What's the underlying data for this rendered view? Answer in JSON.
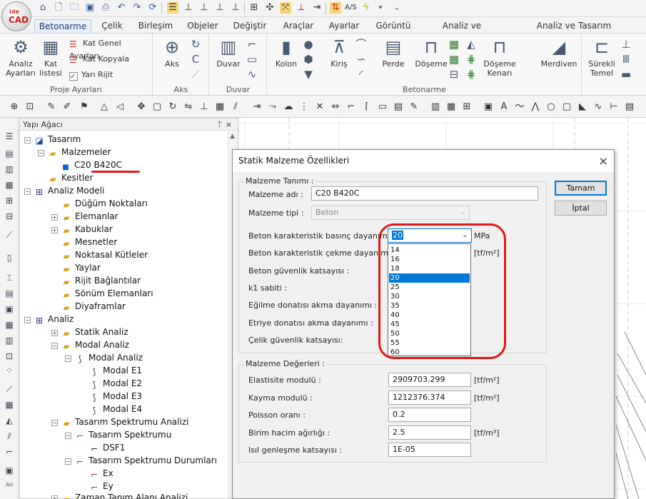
{
  "quick_toolbar": {
    "icons": [
      "home-icon",
      "new-file-icon",
      "open-folder-icon",
      "save-icon",
      "print-icon",
      "print-preview-icon",
      "undo-icon",
      "redo-icon",
      "refresh-icon",
      "select-window-icon",
      "align-left-icon",
      "align-center-icon",
      "align-right-icon",
      "grid-snap-icon",
      "move-icon",
      "snap-active-icon",
      "ortho-icon",
      "pan-icon",
      "snap-end-icon",
      "text-style-icon",
      "lightning-icon",
      "dropdown-icon"
    ],
    "text_label": "A/S"
  },
  "tabs": [
    "Betonarme",
    "Çelik",
    "Birleşim",
    "Objeler",
    "Değiştir",
    "Araçlar",
    "Ayarlar",
    "Görüntü",
    "Analiz ve Tasarım",
    "Analiz ve Tasarım Görüntüleme"
  ],
  "active_tab": "Betonarme",
  "ribbon": {
    "proje": {
      "label": "Proje Ayarları",
      "analiz_btn": "Analiz Ayarları",
      "kat_btn": "Kat listesi",
      "small": [
        "Kat Genel Ayarları",
        "Kat Kopyala",
        "Yarı Rijit"
      ]
    },
    "aks": {
      "label": "Aks",
      "btn": "Aks"
    },
    "duvar": {
      "label": "Duvar",
      "btn": "Duvar"
    },
    "betonarme": {
      "label": "Betonarme",
      "buttons": [
        "Kolon",
        "Kiriş",
        "Perde",
        "Döşeme",
        "Döşeme Kenarı",
        "Merdiven"
      ]
    },
    "temel": {
      "btn": "Sürekli Temel"
    }
  },
  "tree": {
    "header": "Yapı Ağacı",
    "pin": "ᛘ",
    "close": "×",
    "nodes": [
      {
        "text": "Tasarım"
      },
      {
        "text": "Malzemeler"
      },
      {
        "text": "C20 B420C"
      },
      {
        "text": "Kesitler"
      },
      {
        "text": "Analiz Modeli"
      },
      {
        "text": "Düğüm Noktaları"
      },
      {
        "text": "Elemanlar"
      },
      {
        "text": "Kabuklar"
      },
      {
        "text": "Mesnetler"
      },
      {
        "text": "Noktasal Kütleler"
      },
      {
        "text": "Yaylar"
      },
      {
        "text": "Rijit Bağlantılar"
      },
      {
        "text": "Sönüm Elemanları"
      },
      {
        "text": "Diyaframlar"
      },
      {
        "text": "Analiz"
      },
      {
        "text": "Statik Analiz"
      },
      {
        "text": "Modal Analiz"
      },
      {
        "text": "Modal Analiz"
      },
      {
        "text": "Modal E1"
      },
      {
        "text": "Modal E2"
      },
      {
        "text": "Modal E3"
      },
      {
        "text": "Modal E4"
      },
      {
        "text": "Tasarım Spektrumu Analizi"
      },
      {
        "text": "Tasarım Spektrumu"
      },
      {
        "text": "DSF1"
      },
      {
        "text": "Tasarım Spektrumu Durumları"
      },
      {
        "text": "Ex"
      },
      {
        "text": "Ey"
      },
      {
        "text": "Zaman Tanım Alanı Analizi"
      }
    ]
  },
  "dialog": {
    "title": "Statik Malzeme Özellikleri",
    "close": "×",
    "ok": "Tamam",
    "cancel": "İptal",
    "tanim": {
      "legend": "Malzeme Tanımı :",
      "adi_label": "Malzeme adı :",
      "adi_value": "C20 B420C",
      "tipi_label": "Malzeme tipi :",
      "tipi_value": "Beton",
      "basinc_label": "Beton karakteristik basınç dayanımı :",
      "basinc_value": "20",
      "basinc_unit": "MPa",
      "cekme_label": "Beton karakteristik çekme dayanımı :",
      "cekme_unit": "[tf/m²]",
      "guvenlik_label": "Beton güvenlik katsayısı :",
      "k1_label": "k1 sabiti :",
      "egilme_label": "Eğilme donatısı akma dayanımı :",
      "etriye_label": "Etriye donatısı akma dayanımı :",
      "celik_label": "Çelik güvenlik katsayısı:"
    },
    "dropdown_options": [
      "14",
      "16",
      "18",
      "20",
      "25",
      "30",
      "35",
      "40",
      "45",
      "50",
      "55",
      "60"
    ],
    "dropdown_selected": "20",
    "degerler": {
      "legend": "Malzeme Değerleri :",
      "rows": [
        {
          "label": "Elastisite modulü :",
          "value": "2909703.299",
          "unit": "[tf/m²]"
        },
        {
          "label": "Kayma modulü :",
          "value": "1212376.374",
          "unit": "[tf/m²]"
        },
        {
          "label": "Poisson oranı :",
          "value": "0.2",
          "unit": ""
        },
        {
          "label": "Birim hacim ağırlığı :",
          "value": "2.5",
          "unit": "[tf/m³]"
        },
        {
          "label": "Isıl genleşme katsayısı :",
          "value": "1E-05",
          "unit": ""
        }
      ]
    }
  },
  "colors": {
    "accent": "#0078d7",
    "annotation": "#e01818",
    "folder": "#d8a322"
  }
}
